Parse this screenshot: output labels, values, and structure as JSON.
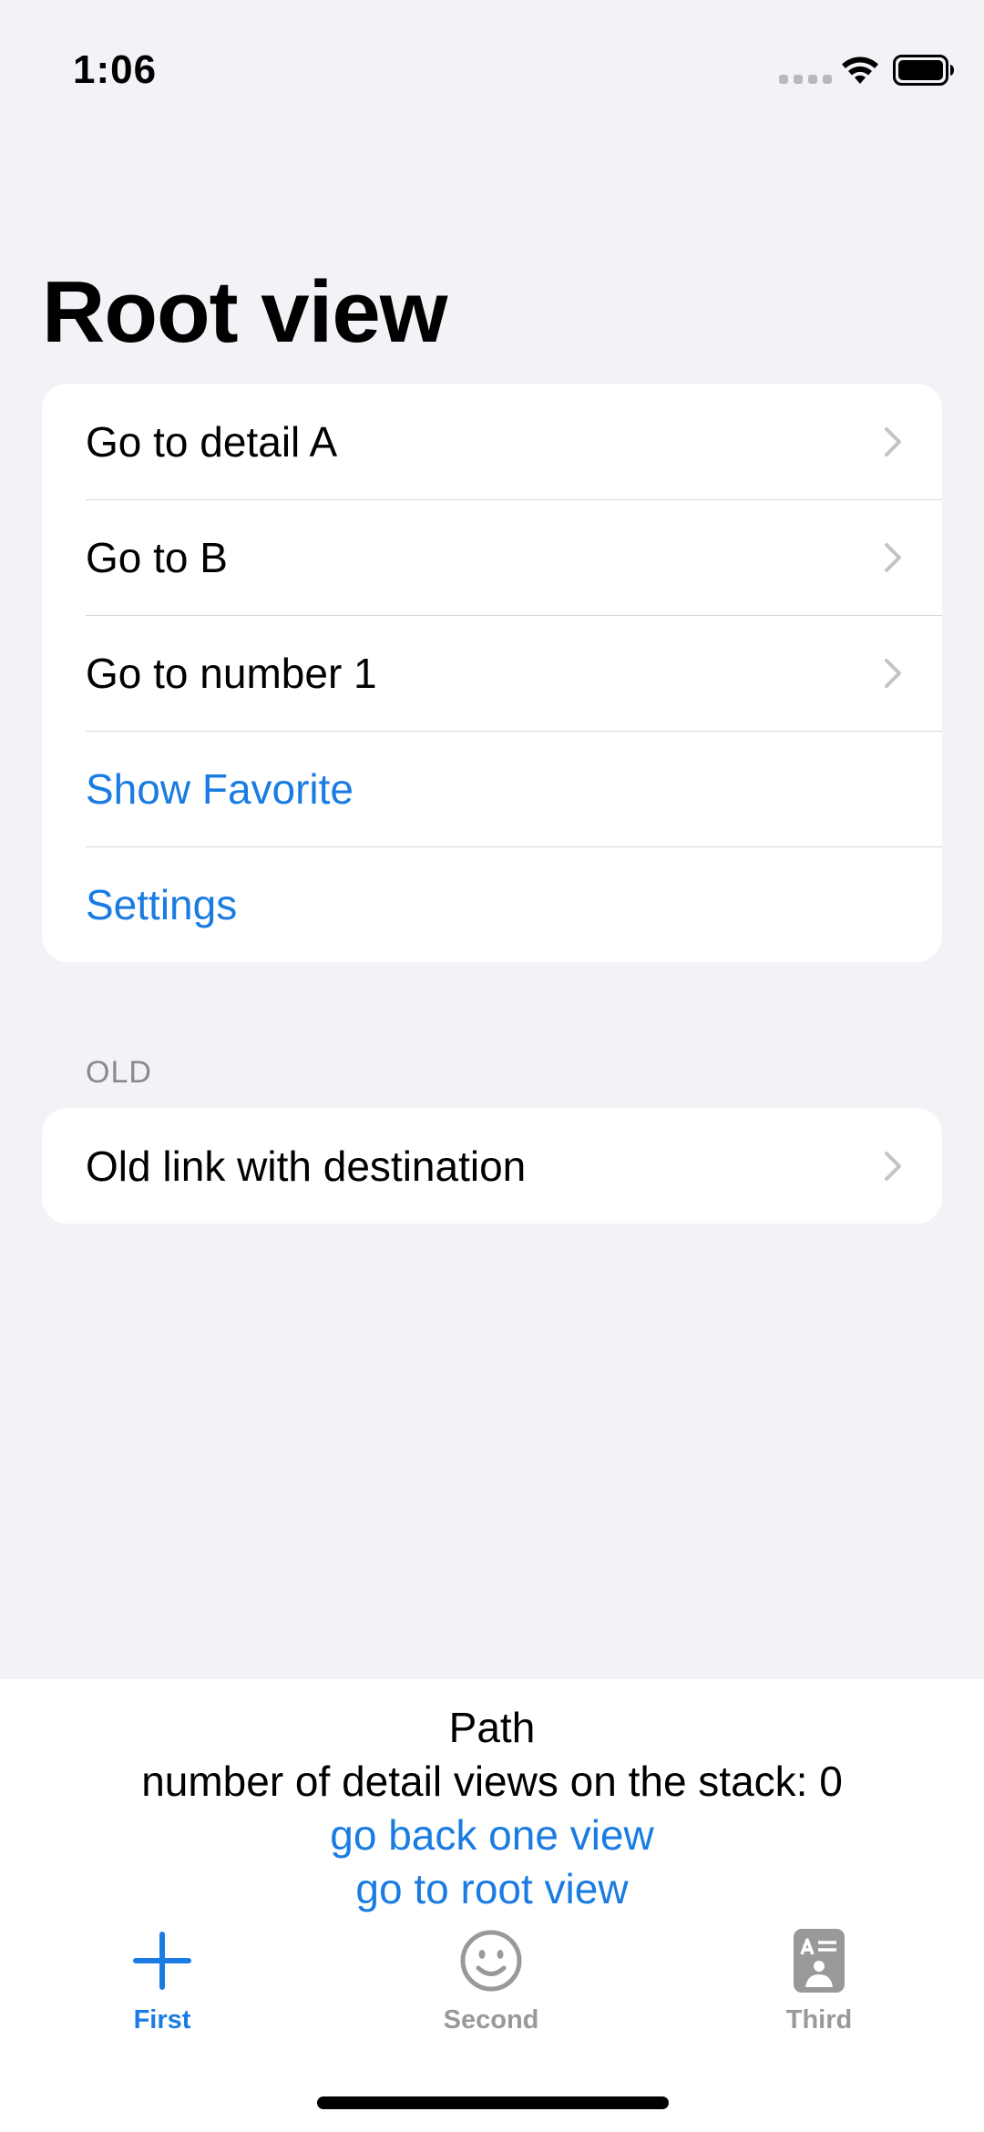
{
  "status_bar": {
    "time": "1:06"
  },
  "page": {
    "title": "Root view"
  },
  "main_list": {
    "items": [
      {
        "label": "Go to detail A",
        "style": "navigation"
      },
      {
        "label": "Go to B",
        "style": "navigation"
      },
      {
        "label": "Go to number 1",
        "style": "navigation"
      },
      {
        "label": "Show Favorite",
        "style": "button"
      },
      {
        "label": "Settings",
        "style": "button"
      }
    ]
  },
  "old_section": {
    "header": "OLD",
    "items": [
      {
        "label": "Old link with destination",
        "style": "navigation"
      }
    ]
  },
  "path_panel": {
    "title": "Path",
    "count_text": "number of detail views on the stack: 0",
    "back_label": "go back one view",
    "root_label": "go to root view"
  },
  "tab_bar": {
    "tabs": [
      {
        "label": "First",
        "icon": "plus-icon",
        "selected": true
      },
      {
        "label": "Second",
        "icon": "smiley-icon",
        "selected": false
      },
      {
        "label": "Third",
        "icon": "contact-card-icon",
        "selected": false
      }
    ]
  },
  "colors": {
    "accent": "#1a7ce2",
    "background": "#f2f2f7",
    "inactive_tab": "#999999"
  }
}
